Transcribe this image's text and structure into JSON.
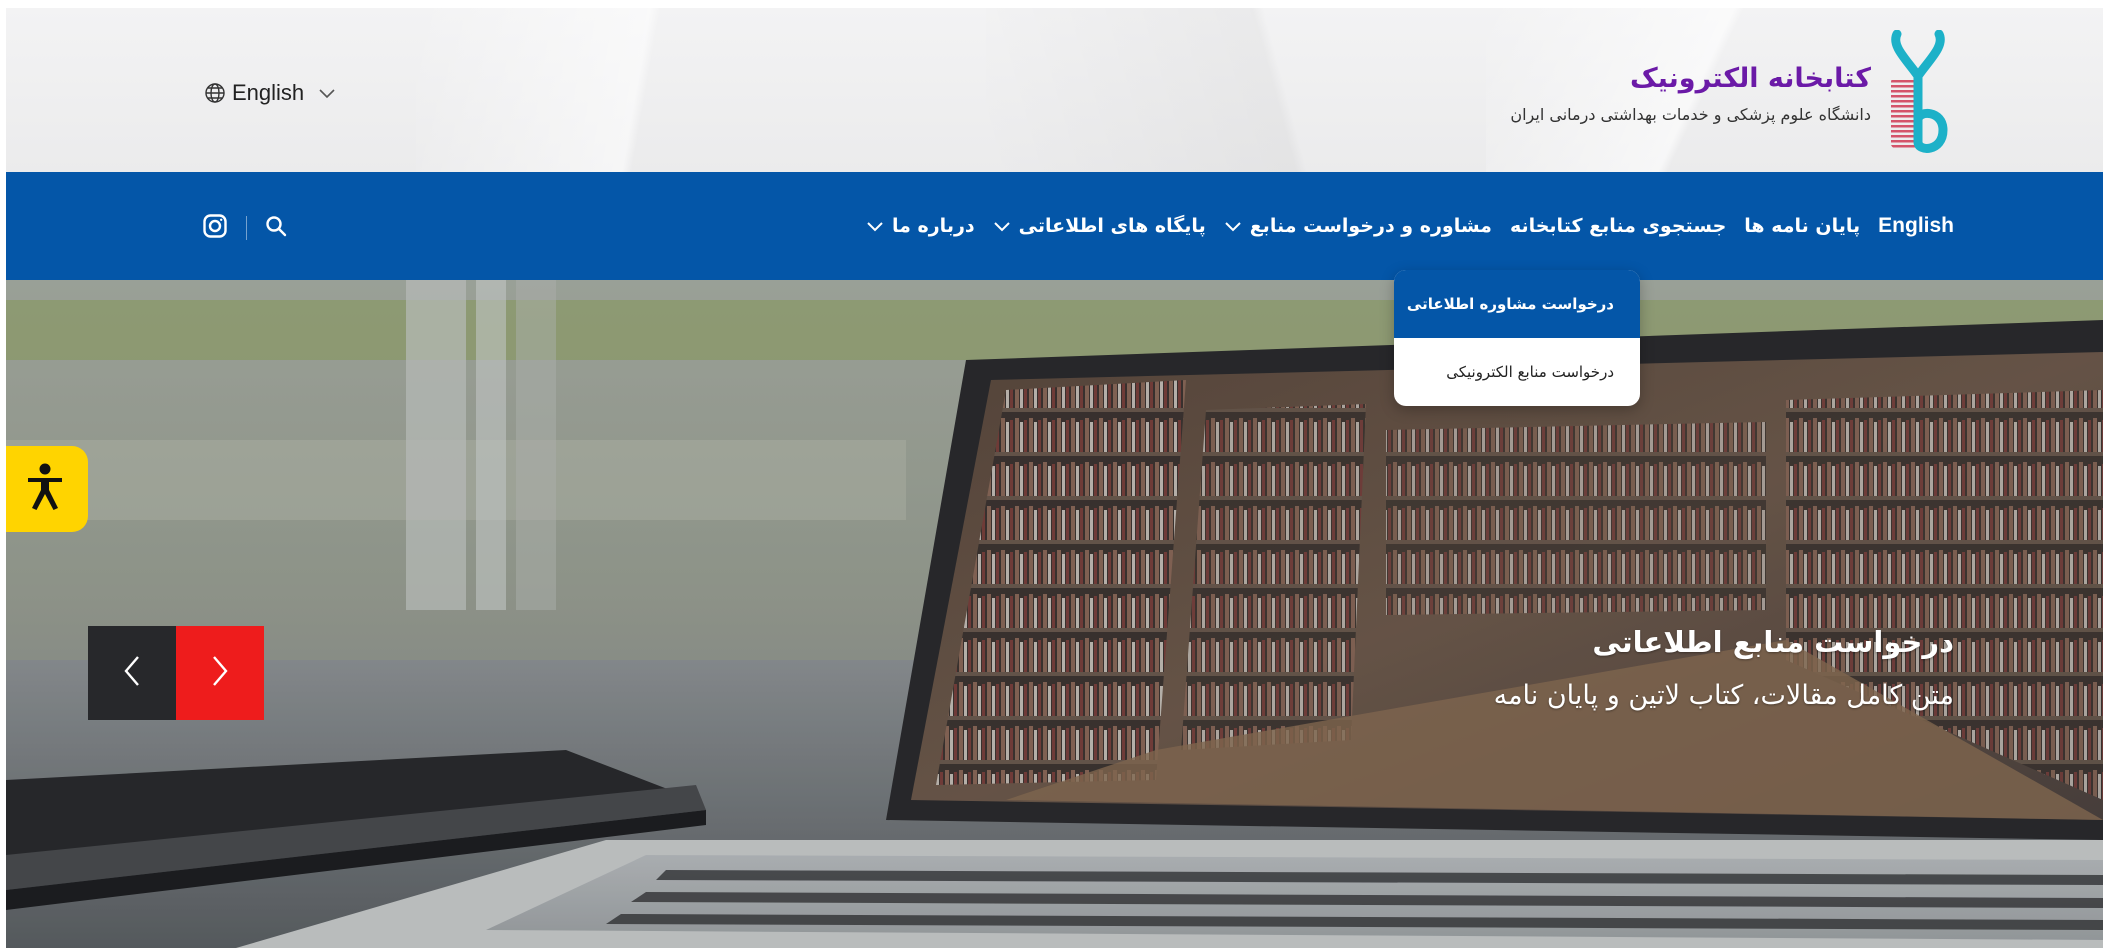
{
  "header": {
    "brand_title": "کتابخانه الکترونیک",
    "brand_subtitle": "دانشگاه علوم پزشکی و خدمات بهداشتی درمانی ایران",
    "language_label": "English"
  },
  "nav": {
    "items": [
      {
        "label": "درباره ما",
        "has_dropdown": true
      },
      {
        "label": "پایگاه های اطلاعاتی",
        "has_dropdown": true
      },
      {
        "label": "مشاوره و درخواست منابع",
        "has_dropdown": true
      },
      {
        "label": "جستجوی منابع کتابخانه",
        "has_dropdown": false
      },
      {
        "label": "پایان نامه ها",
        "has_dropdown": false
      },
      {
        "label": "English",
        "has_dropdown": false
      }
    ],
    "dropdown_items": [
      {
        "label": "درخواست مشاوره اطلاعاتی",
        "active": true
      },
      {
        "label": "درخواست منابع الکترونیکی",
        "active": false
      }
    ]
  },
  "hero": {
    "title": "درخواست منابع اطلاعاتی",
    "subtitle": "متن کامل مقالات، کتاب لاتین و پایان نامه"
  },
  "icons": {
    "language": "globe-icon",
    "search": "search-icon",
    "social": "instagram-icon",
    "accessibility": "accessibility-icon",
    "prev": "chevron-left-icon",
    "next": "chevron-right-icon"
  },
  "colors": {
    "nav_bg": "#0456a8",
    "brand_title": "#6b1aa7",
    "next_button": "#ee1c1c",
    "prev_button": "#27282b",
    "accessibility_bg": "#ffd400"
  }
}
